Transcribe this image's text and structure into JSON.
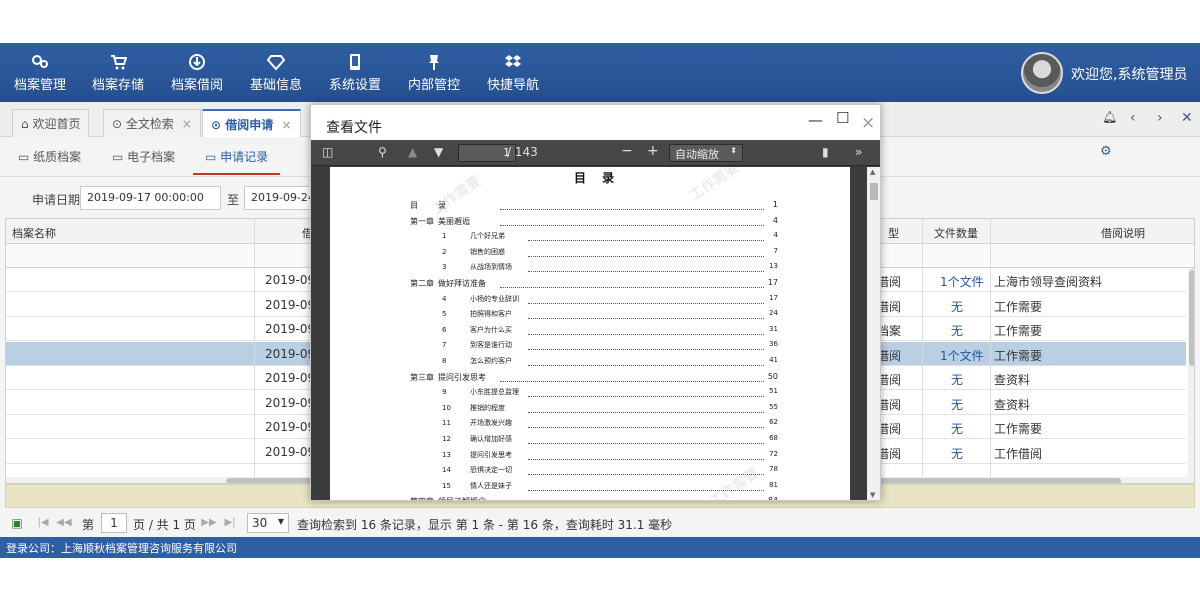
{
  "nav": [
    {
      "label": "档案管理",
      "icon": "gears-icon"
    },
    {
      "label": "档案存储",
      "icon": "cart-icon"
    },
    {
      "label": "档案借阅",
      "icon": "circle-down-icon"
    },
    {
      "label": "基础信息",
      "icon": "diamond-icon"
    },
    {
      "label": "系统设置",
      "icon": "tablet-icon"
    },
    {
      "label": "内部管控",
      "icon": "pin-icon"
    },
    {
      "label": "快捷导航",
      "icon": "dropbox-icon"
    }
  ],
  "user": {
    "welcome": "欢迎您,系统管理员"
  },
  "tabs": [
    {
      "label": "欢迎首页"
    },
    {
      "label": "全文检索"
    },
    {
      "label": "借阅申请"
    }
  ],
  "subtabs": [
    {
      "label": "纸质档案"
    },
    {
      "label": "电子档案"
    },
    {
      "label": "申请记录"
    }
  ],
  "filter": {
    "date_label": "申请日期:",
    "date_from": "2019-09-17 00:00:00",
    "to_label": "至",
    "date_to": "2019-09-24"
  },
  "table": {
    "headers": [
      "档案名称",
      "借",
      "型",
      "文件数量",
      "借阅说明"
    ],
    "rows": [
      {
        "date": "2019-09",
        "type": "借阅",
        "count": "1个文件",
        "note": "上海市领导查阅资料"
      },
      {
        "date": "2019-09",
        "type": "借阅",
        "count": "无",
        "note": "工作需要"
      },
      {
        "date": "2019-09",
        "type": "档案",
        "count": "无",
        "note": "工作需要"
      },
      {
        "date": "2019-09",
        "type": "借阅",
        "count": "1个文件",
        "note": "工作需要"
      },
      {
        "date": "2019-09",
        "type": "借阅",
        "count": "无",
        "note": "查资料"
      },
      {
        "date": "2019-09",
        "type": "借阅",
        "count": "无",
        "note": "查资料"
      },
      {
        "date": "2019-09",
        "type": "借阅",
        "count": "无",
        "note": "工作需要"
      },
      {
        "date": "2019-09",
        "type": "借阅",
        "count": "无",
        "note": "工作借阅"
      }
    ]
  },
  "pager": {
    "page_label": "第",
    "page": "1",
    "total_label": "页 / 共 1 页",
    "page_size": "30",
    "summary": "查询检索到 16 条记录，显示 第 1 条 - 第 16 条，查询耗时 31.1 毫秒"
  },
  "footer": {
    "text": "登录公司：上海顺秋档案管理咨询服务有限公司"
  },
  "modal": {
    "title": "查看文件",
    "viewer": {
      "page": "1",
      "total": "/ 143",
      "zoom": "自动缩放",
      "doc_title": "目 录",
      "watermark": "工作需要",
      "toc": [
        {
          "num": "目",
          "title": "录",
          "page": "1",
          "level": 0
        },
        {
          "num": "第一章",
          "title": "美丽邂逅",
          "page": "4",
          "level": 0
        },
        {
          "num": "1",
          "title": "几个好兄弟",
          "page": "4",
          "level": 1
        },
        {
          "num": "2",
          "title": "销售的困惑",
          "page": "7",
          "level": 1
        },
        {
          "num": "3",
          "title": "从战场到情场",
          "page": "13",
          "level": 1
        },
        {
          "num": "第二章",
          "title": "做好拜访准备",
          "page": "17",
          "level": 0
        },
        {
          "num": "4",
          "title": "小杨的专业辞训",
          "page": "17",
          "level": 1
        },
        {
          "num": "5",
          "title": "拍照得和客户",
          "page": "24",
          "level": 1
        },
        {
          "num": "6",
          "title": "客户为什么买",
          "page": "31",
          "level": 1
        },
        {
          "num": "7",
          "title": "到客是谁行动",
          "page": "36",
          "level": 1
        },
        {
          "num": "8",
          "title": "怎么预约客户",
          "page": "41",
          "level": 1
        },
        {
          "num": "第三章",
          "title": "提问引发思考",
          "page": "50",
          "level": 0
        },
        {
          "num": "9",
          "title": "小东胜提总监理",
          "page": "51",
          "level": 1
        },
        {
          "num": "10",
          "title": "推销的程度",
          "page": "55",
          "level": 1
        },
        {
          "num": "11",
          "title": "开场激发兴趣",
          "page": "62",
          "level": 1
        },
        {
          "num": "12",
          "title": "确认增加好感",
          "page": "68",
          "level": 1
        },
        {
          "num": "13",
          "title": "提问引发思考",
          "page": "72",
          "level": 1
        },
        {
          "num": "14",
          "title": "恐惧决定一切",
          "page": "78",
          "level": 1
        },
        {
          "num": "15",
          "title": "情人还是妹子",
          "page": "81",
          "level": 1
        },
        {
          "num": "第四章",
          "title": "领导了解概念",
          "page": "84",
          "level": 0
        }
      ]
    }
  },
  "colors": {
    "brand": "#2f5fa3",
    "selected_row": "#b9cfe3",
    "link": "#2255a4",
    "active_tab_underline": "#c0392b"
  }
}
